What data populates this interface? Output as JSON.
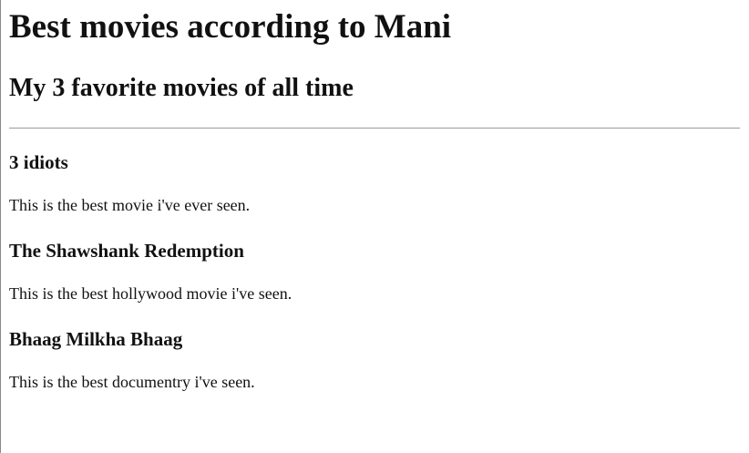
{
  "page": {
    "title": "Best movies according to Mani",
    "subtitle": "My 3 favorite movies of all time"
  },
  "movies": [
    {
      "title": "3 idiots",
      "description": "This is the best movie i've ever seen."
    },
    {
      "title": "The Shawshank Redemption",
      "description": "This is the best hollywood movie i've seen."
    },
    {
      "title": "Bhaag Milkha Bhaag",
      "description": "This is the best documentry i've seen."
    }
  ]
}
